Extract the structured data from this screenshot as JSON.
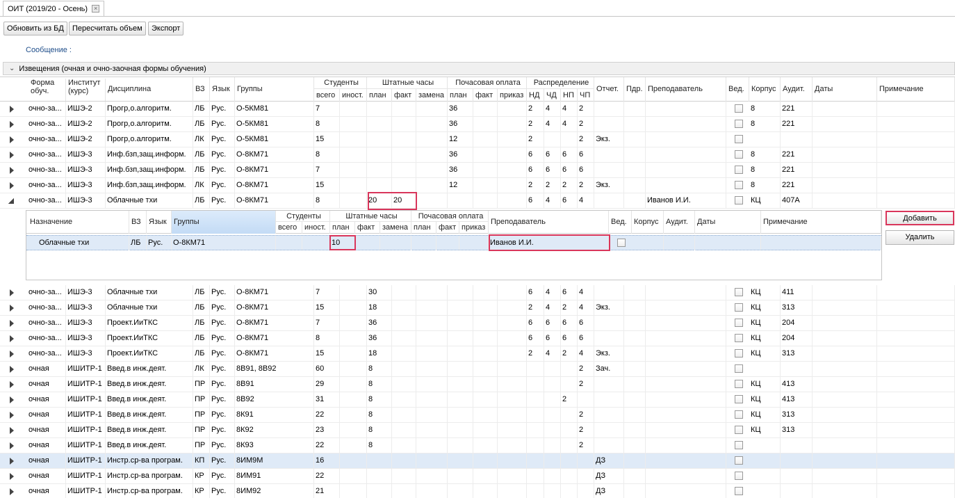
{
  "tab": {
    "title": "ОИТ (2019/20 - Осень)"
  },
  "toolbar": {
    "refresh": "Обновить из БД",
    "recalc": "Пересчитать объем",
    "export": "Экспорт"
  },
  "message": {
    "label": "Сообщение :"
  },
  "panel": {
    "title": "Извещения (очная и очно-заочная формы обучения)"
  },
  "headers": {
    "form": "Форма обуч.",
    "form1": "Форма",
    "form2": "обуч.",
    "inst1": "Институт",
    "inst2": "(курс)",
    "disc": "Дисциплина",
    "vz": "ВЗ",
    "lang": "Язык",
    "groups": "Группы",
    "students": "Студенты",
    "st_total": "всего",
    "st_foreign": "иност.",
    "staff": "Штатные часы",
    "sh_plan": "план",
    "sh_fact": "факт",
    "sh_repl": "замена",
    "hourly": "Почасовая оплата",
    "hp_plan": "план",
    "hp_fact": "факт",
    "hp_order": "приказ",
    "distr": "Распределение",
    "d_nd": "НД",
    "d_chd": "ЧД",
    "d_np": "НП",
    "d_chp": "ЧП",
    "report": "Отчет.",
    "dept": "Пдр.",
    "teacher": "Преподаватель",
    "ved": "Вед.",
    "corp": "Корпус",
    "aud": "Аудит.",
    "dates": "Даты",
    "note": "Примечание"
  },
  "rows": [
    {
      "form": "очно-за...",
      "inst": "ИШЭ-2",
      "disc": "Прогр,о.алгоритм.",
      "vz": "ЛБ",
      "lang": "Рус.",
      "groups": "О-5КМ81",
      "total": "7",
      "sh_plan": "",
      "sh_fact": "",
      "hp_plan": "36",
      "nd": "2",
      "chd": "4",
      "np": "4",
      "chp": "2",
      "report": "",
      "teacher": "",
      "corp": "8",
      "aud": "221"
    },
    {
      "form": "очно-за...",
      "inst": "ИШЭ-2",
      "disc": "Прогр,о.алгоритм.",
      "vz": "ЛБ",
      "lang": "Рус.",
      "groups": "О-5КМ81",
      "total": "8",
      "sh_plan": "",
      "sh_fact": "",
      "hp_plan": "36",
      "nd": "2",
      "chd": "4",
      "np": "4",
      "chp": "2",
      "report": "",
      "teacher": "",
      "corp": "8",
      "aud": "221"
    },
    {
      "form": "очно-за...",
      "inst": "ИШЭ-2",
      "disc": "Прогр,о.алгоритм.",
      "vz": "ЛК",
      "lang": "Рус.",
      "groups": "О-5КМ81",
      "total": "15",
      "sh_plan": "",
      "sh_fact": "",
      "hp_plan": "12",
      "nd": "2",
      "chd": "",
      "np": "",
      "chp": "2",
      "report": "Экз.",
      "teacher": "",
      "corp": "",
      "aud": ""
    },
    {
      "form": "очно-за...",
      "inst": "ИШЭ-3",
      "disc": "Инф.бзп,защ.информ.",
      "vz": "ЛБ",
      "lang": "Рус.",
      "groups": "О-8КМ71",
      "total": "8",
      "sh_plan": "",
      "sh_fact": "",
      "hp_plan": "36",
      "nd": "6",
      "chd": "6",
      "np": "6",
      "chp": "6",
      "report": "",
      "teacher": "",
      "corp": "8",
      "aud": "221"
    },
    {
      "form": "очно-за...",
      "inst": "ИШЭ-3",
      "disc": "Инф.бзп,защ.информ.",
      "vz": "ЛБ",
      "lang": "Рус.",
      "groups": "О-8КМ71",
      "total": "7",
      "sh_plan": "",
      "sh_fact": "",
      "hp_plan": "36",
      "nd": "6",
      "chd": "6",
      "np": "6",
      "chp": "6",
      "report": "",
      "teacher": "",
      "corp": "8",
      "aud": "221"
    },
    {
      "form": "очно-за...",
      "inst": "ИШЭ-3",
      "disc": "Инф.бзп,защ.информ.",
      "vz": "ЛК",
      "lang": "Рус.",
      "groups": "О-8КМ71",
      "total": "15",
      "sh_plan": "",
      "sh_fact": "",
      "hp_plan": "12",
      "nd": "2",
      "chd": "2",
      "np": "2",
      "chp": "2",
      "report": "Экз.",
      "teacher": "",
      "corp": "8",
      "aud": "221"
    },
    {
      "form": "очно-за...",
      "inst": "ИШЭ-3",
      "disc": "Облачные тхи",
      "vz": "ЛБ",
      "lang": "Рус.",
      "groups": "О-8КМ71",
      "total": "8",
      "sh_plan": "20",
      "sh_fact": "20",
      "hp_plan": "",
      "nd": "6",
      "chd": "4",
      "np": "6",
      "chp": "4",
      "report": "",
      "teacher": "Иванов И.И.",
      "corp": "КЦ",
      "aud": "407А",
      "expanded": true
    },
    {
      "form": "очно-за...",
      "inst": "ИШЭ-3",
      "disc": "Облачные тхи",
      "vz": "ЛБ",
      "lang": "Рус.",
      "groups": "О-8КМ71",
      "total": "7",
      "sh_plan": "30",
      "sh_fact": "",
      "hp_plan": "",
      "nd": "6",
      "chd": "4",
      "np": "6",
      "chp": "4",
      "report": "",
      "teacher": "",
      "corp": "КЦ",
      "aud": "411"
    },
    {
      "form": "очно-за...",
      "inst": "ИШЭ-3",
      "disc": "Облачные тхи",
      "vz": "ЛБ",
      "lang": "Рус.",
      "groups": "О-8КМ71",
      "total": "15",
      "sh_plan": "18",
      "sh_fact": "",
      "hp_plan": "",
      "nd": "2",
      "chd": "4",
      "np": "2",
      "chp": "4",
      "report": "Экз.",
      "teacher": "",
      "corp": "КЦ",
      "aud": "313"
    },
    {
      "form": "очно-за...",
      "inst": "ИШЭ-3",
      "disc": "Проект.ИиТКС",
      "vz": "ЛБ",
      "lang": "Рус.",
      "groups": "О-8КМ71",
      "total": "7",
      "sh_plan": "36",
      "sh_fact": "",
      "hp_plan": "",
      "nd": "6",
      "chd": "6",
      "np": "6",
      "chp": "6",
      "report": "",
      "teacher": "",
      "corp": "КЦ",
      "aud": "204"
    },
    {
      "form": "очно-за...",
      "inst": "ИШЭ-3",
      "disc": "Проект.ИиТКС",
      "vz": "ЛБ",
      "lang": "Рус.",
      "groups": "О-8КМ71",
      "total": "8",
      "sh_plan": "36",
      "sh_fact": "",
      "hp_plan": "",
      "nd": "6",
      "chd": "6",
      "np": "6",
      "chp": "6",
      "report": "",
      "teacher": "",
      "corp": "КЦ",
      "aud": "204"
    },
    {
      "form": "очно-за...",
      "inst": "ИШЭ-3",
      "disc": "Проект.ИиТКС",
      "vz": "ЛБ",
      "lang": "Рус.",
      "groups": "О-8КМ71",
      "total": "15",
      "sh_plan": "18",
      "sh_fact": "",
      "hp_plan": "",
      "nd": "2",
      "chd": "4",
      "np": "2",
      "chp": "4",
      "report": "Экз.",
      "teacher": "",
      "corp": "КЦ",
      "aud": "313"
    },
    {
      "form": "очная",
      "inst": "ИШИТР-1",
      "disc": "Введ.в инж.деят.",
      "vz": "ЛК",
      "lang": "Рус.",
      "groups": "8В91, 8В92",
      "total": "60",
      "sh_plan": "8",
      "sh_fact": "",
      "hp_plan": "",
      "nd": "",
      "chd": "",
      "np": "",
      "chp": "2",
      "report": "Зач.",
      "teacher": "",
      "corp": "",
      "aud": ""
    },
    {
      "form": "очная",
      "inst": "ИШИТР-1",
      "disc": "Введ.в инж.деят.",
      "vz": "ПР",
      "lang": "Рус.",
      "groups": "8В91",
      "total": "29",
      "sh_plan": "8",
      "sh_fact": "",
      "hp_plan": "",
      "nd": "",
      "chd": "",
      "np": "",
      "chp": "2",
      "report": "",
      "teacher": "",
      "corp": "КЦ",
      "aud": "413"
    },
    {
      "form": "очная",
      "inst": "ИШИТР-1",
      "disc": "Введ.в инж.деят.",
      "vz": "ПР",
      "lang": "Рус.",
      "groups": "8В92",
      "total": "31",
      "sh_plan": "8",
      "sh_fact": "",
      "hp_plan": "",
      "nd": "",
      "chd": "",
      "np": "2",
      "chp": "",
      "report": "",
      "teacher": "",
      "corp": "КЦ",
      "aud": "413"
    },
    {
      "form": "очная",
      "inst": "ИШИТР-1",
      "disc": "Введ.в инж.деят.",
      "vz": "ПР",
      "lang": "Рус.",
      "groups": "8К91",
      "total": "22",
      "sh_plan": "8",
      "sh_fact": "",
      "hp_plan": "",
      "nd": "",
      "chd": "",
      "np": "",
      "chp": "2",
      "report": "",
      "teacher": "",
      "corp": "КЦ",
      "aud": "313"
    },
    {
      "form": "очная",
      "inst": "ИШИТР-1",
      "disc": "Введ.в инж.деят.",
      "vz": "ПР",
      "lang": "Рус.",
      "groups": "8К92",
      "total": "23",
      "sh_plan": "8",
      "sh_fact": "",
      "hp_plan": "",
      "nd": "",
      "chd": "",
      "np": "",
      "chp": "2",
      "report": "",
      "teacher": "",
      "corp": "КЦ",
      "aud": "313"
    },
    {
      "form": "очная",
      "inst": "ИШИТР-1",
      "disc": "Введ.в инж.деят.",
      "vz": "ПР",
      "lang": "Рус.",
      "groups": "8К93",
      "total": "22",
      "sh_plan": "8",
      "sh_fact": "",
      "hp_plan": "",
      "nd": "",
      "chd": "",
      "np": "",
      "chp": "2",
      "report": "",
      "teacher": "",
      "corp": "",
      "aud": ""
    },
    {
      "form": "очная",
      "inst": "ИШИТР-1",
      "disc": "Инстр.ср-ва програм.",
      "vz": "КП",
      "lang": "Рус.",
      "groups": "8ИМ9М",
      "total": "16",
      "sh_plan": "",
      "sh_fact": "",
      "hp_plan": "",
      "nd": "",
      "chd": "",
      "np": "",
      "chp": "",
      "report": "ДЗ",
      "teacher": "",
      "corp": "",
      "aud": "",
      "selected": true
    },
    {
      "form": "очная",
      "inst": "ИШИТР-1",
      "disc": "Инстр.ср-ва програм.",
      "vz": "КР",
      "lang": "Рус.",
      "groups": "8ИМ91",
      "total": "22",
      "sh_plan": "",
      "sh_fact": "",
      "hp_plan": "",
      "nd": "",
      "chd": "",
      "np": "",
      "chp": "",
      "report": "ДЗ",
      "teacher": "",
      "corp": "",
      "aud": ""
    },
    {
      "form": "очная",
      "inst": "ИШИТР-1",
      "disc": "Инстр.ср-ва програм.",
      "vz": "КР",
      "lang": "Рус.",
      "groups": "8ИМ92",
      "total": "21",
      "sh_plan": "",
      "sh_fact": "",
      "hp_plan": "",
      "nd": "",
      "chd": "",
      "np": "",
      "chp": "",
      "report": "ДЗ",
      "teacher": "",
      "corp": "",
      "aud": ""
    }
  ],
  "subgrid": {
    "headers": {
      "purpose": "Назначение",
      "vz": "ВЗ",
      "lang": "Язык",
      "groups": "Группы",
      "students": "Студенты",
      "total": "всего",
      "foreign": "иност.",
      "staff": "Штатные часы",
      "plan": "план",
      "fact": "факт",
      "repl": "замена",
      "hourly": "Почасовая оплата",
      "hplan": "план",
      "hfact": "факт",
      "horder": "приказ",
      "teacher": "Преподаватель",
      "ved": "Вед.",
      "corp": "Корпус",
      "aud": "Аудит.",
      "dates": "Даты",
      "note": "Примечание"
    },
    "row": {
      "purpose": "Облачные тхи",
      "vz": "ЛБ",
      "lang": "Рус.",
      "groups": "О-8КМ71",
      "plan": "10",
      "teacher": "Иванов И.И."
    }
  },
  "actions": {
    "add": "Добавить",
    "delete": "Удалить"
  }
}
